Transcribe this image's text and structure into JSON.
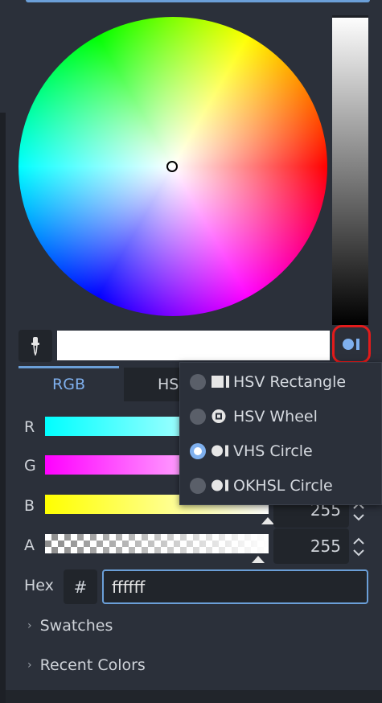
{
  "tabs": [
    {
      "label": "RGB",
      "selected": true
    },
    {
      "label": "HS",
      "selected": false
    }
  ],
  "channels": [
    {
      "label": "R",
      "value": ""
    },
    {
      "label": "G",
      "value": ""
    },
    {
      "label": "B",
      "value": "255"
    },
    {
      "label": "A",
      "value": "255"
    }
  ],
  "hex": {
    "label": "Hex",
    "prefix": "#",
    "value": "ffffff"
  },
  "sections": {
    "swatches": "Swatches",
    "recent": "Recent Colors"
  },
  "mode_menu": {
    "items": [
      {
        "label": "HSV Rectangle",
        "checked": false,
        "icon": "rectangle-mode-icon"
      },
      {
        "label": "HSV Wheel",
        "checked": false,
        "icon": "wheel-mode-icon"
      },
      {
        "label": "VHS Circle",
        "checked": true,
        "icon": "circle-mode-icon"
      },
      {
        "label": "OKHSL Circle",
        "checked": false,
        "icon": "circle-mode-icon"
      }
    ]
  },
  "colors": {
    "accent": "#7fb0ee",
    "highlight_ring": "#e21b1b",
    "current_color": "#ffffff"
  }
}
